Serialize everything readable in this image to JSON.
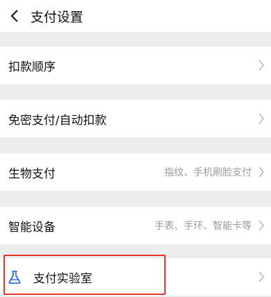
{
  "header": {
    "title": "支付设置"
  },
  "menu": {
    "deduction_order": {
      "label": "扣款顺序"
    },
    "passwordless": {
      "label": "免密支付/自动扣款"
    },
    "biometric": {
      "label": "生物支付",
      "hint": "指纹、手机刷脸支付"
    },
    "smart_devices": {
      "label": "智能设备",
      "hint": "手表、手环、智能卡等"
    },
    "payment_lab": {
      "label": "支付实验室"
    }
  },
  "colors": {
    "background": "#ededed",
    "row": "#ffffff",
    "text": "#111111",
    "hint": "#9a9a9a",
    "highlight": "#e8312a",
    "lab_icon": "#2d6cdf"
  }
}
